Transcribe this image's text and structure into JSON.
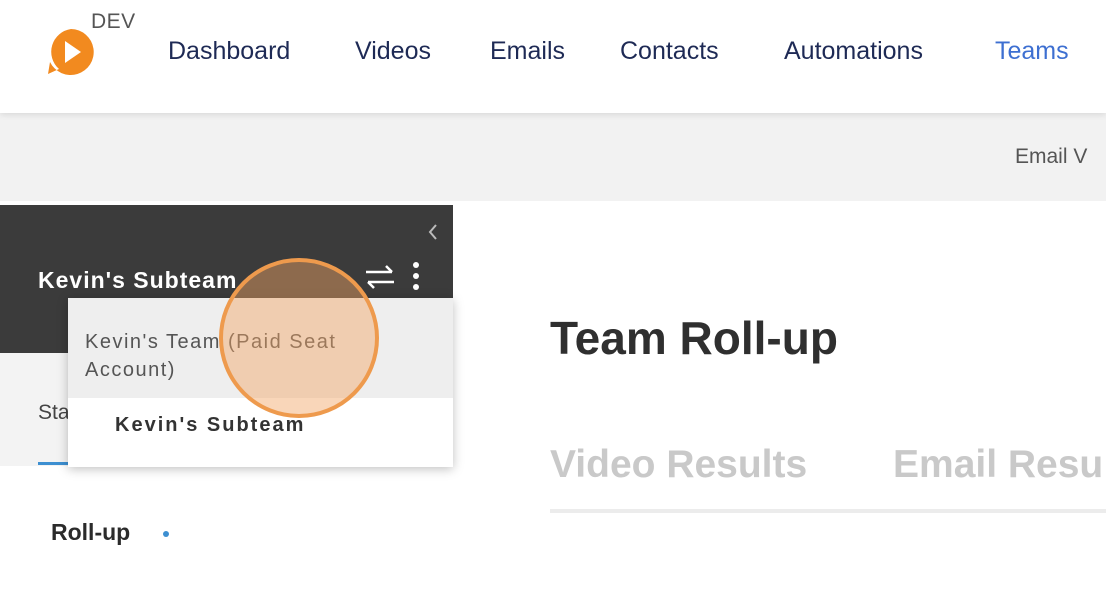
{
  "nav": {
    "env_label": "DEV",
    "items": [
      {
        "label": "Dashboard",
        "active": false
      },
      {
        "label": "Videos",
        "active": false
      },
      {
        "label": "Emails",
        "active": false
      },
      {
        "label": "Contacts",
        "active": false
      },
      {
        "label": "Automations",
        "active": false
      },
      {
        "label": "Teams",
        "active": true
      }
    ]
  },
  "subbar": {
    "link": "Email V"
  },
  "sidebar": {
    "team_name": "Kevin's Subteam",
    "tab_label": "Stats",
    "item": "Roll-up"
  },
  "dropdown": {
    "options": [
      "Kevin's Team (Paid Seat Account)",
      "Kevin's Subteam"
    ]
  },
  "main": {
    "title": "Team Roll-up",
    "tabs": [
      "Video Results",
      "Email Resu"
    ]
  },
  "colors": {
    "accent": "#3d6fd1",
    "logo": "#f28a1f",
    "sidebar_header": "#3b3b3b",
    "highlight": "#ee9a4d"
  }
}
